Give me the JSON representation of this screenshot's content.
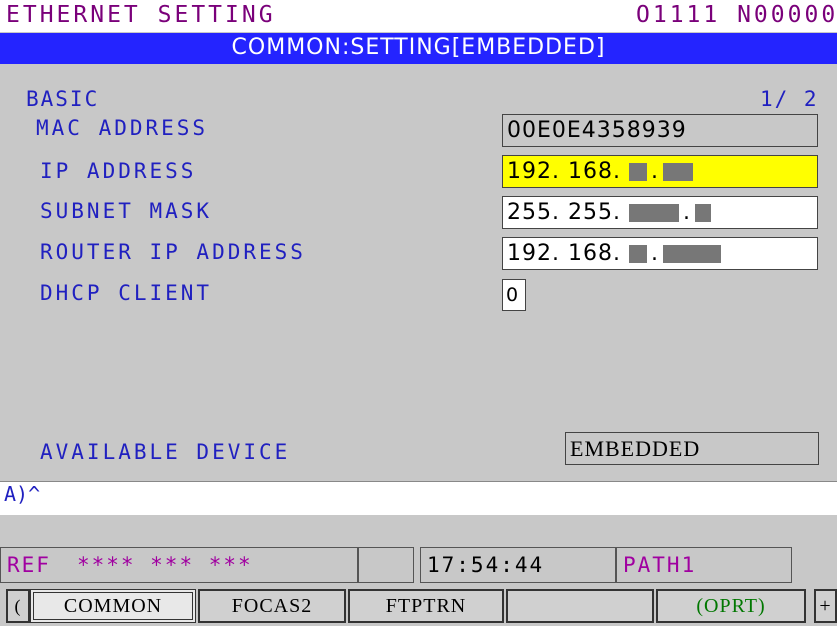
{
  "header": {
    "title": "ETHERNET SETTING",
    "program": "O1111 N00000"
  },
  "subheader": "COMMON:SETTING[EMBEDDED]",
  "section": {
    "name": "BASIC",
    "page": "1/ 2"
  },
  "fields": {
    "mac_label": "MAC ADDRESS",
    "mac_value": "00E0E4358939",
    "ip_label": "IP ADDRESS",
    "ip_prefix": "192. 168.",
    "subnet_label": "SUBNET MASK",
    "subnet_prefix": "255. 255.",
    "router_label": "ROUTER IP ADDRESS",
    "router_prefix": "192. 168.",
    "dhcp_label": "DHCP CLIENT",
    "dhcp_value": "0",
    "device_label": "AVAILABLE DEVICE",
    "device_value": "EMBEDDED"
  },
  "command_line": "A)^",
  "status": {
    "mode": "REF",
    "stars": "**** *** ***",
    "time": "17:54:44",
    "path": "PATH1"
  },
  "softkeys": {
    "prev": "(",
    "common": "COMMON",
    "focas2": "FOCAS2",
    "ftptrn": "FTPTRN",
    "blank": "",
    "oprt": "(OPRT)",
    "next": "+"
  },
  "colors": {
    "title_text": "#7a007a",
    "accent_bar": "#2424ff",
    "label_text": "#2020c0",
    "highlight_field": "#ffff00"
  }
}
